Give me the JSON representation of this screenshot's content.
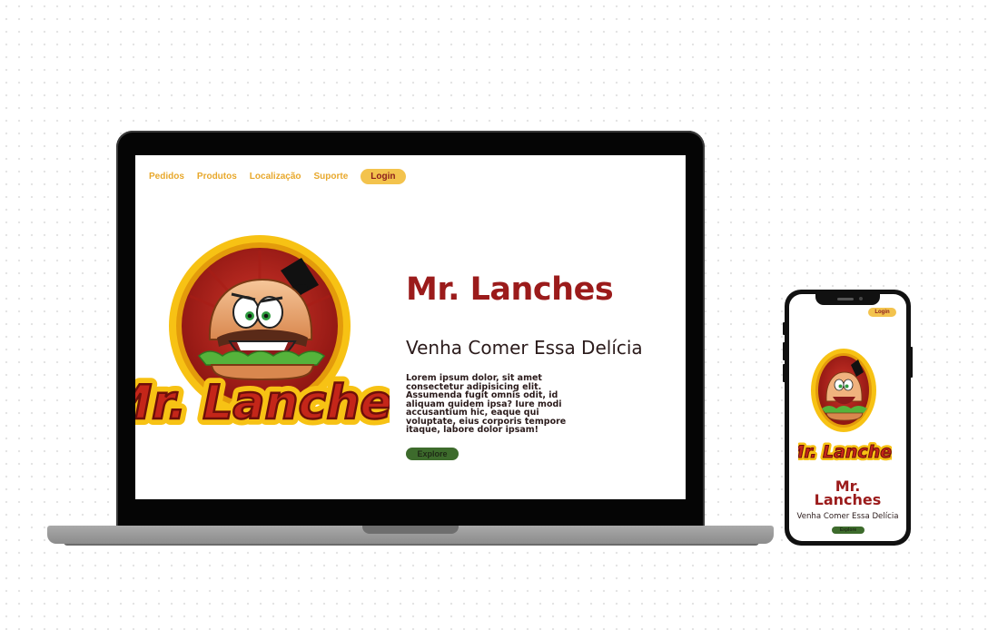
{
  "nav": {
    "links": [
      "Pedidos",
      "Produtos",
      "Localização",
      "Suporte"
    ],
    "login_label": "Login"
  },
  "hero": {
    "title": "Mr. Lanches",
    "subtitle": "Venha Comer Essa Delícia",
    "body": "Lorem ipsum dolor, sit amet consectetur adipisicing elit. Assumenda fugit omnis odit, id aliquam quidem ipsa? Iure modi accusantium hic, eaque qui voluptate, eius corporis tempore itaque, labore dolor ipsam!",
    "explore_label": "Explore"
  },
  "logo": {
    "wordmark": "Mr. Lanches"
  },
  "mobile": {
    "login_label": "Login",
    "title_line1": "Mr.",
    "title_line2": "Lanches",
    "subtitle": "Venha Comer Essa Delícia",
    "explore_label": "Explore"
  },
  "colors": {
    "brand_red": "#9b1b1b",
    "brand_yellow": "#f3c34d",
    "nav_text": "#e8a82c",
    "explore_green": "#3d6b2c"
  }
}
